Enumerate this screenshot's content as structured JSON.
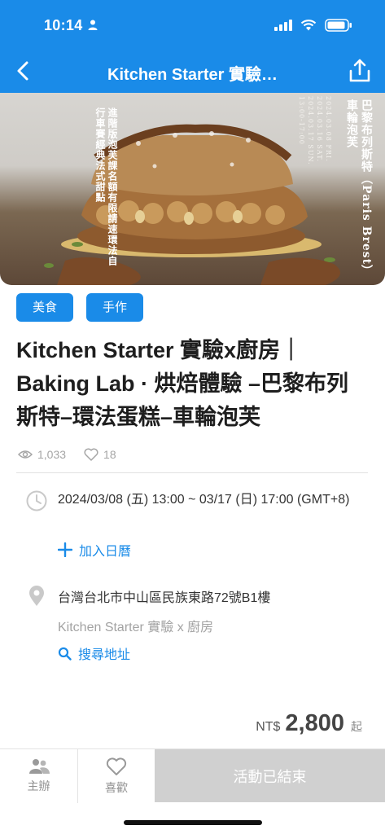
{
  "status_bar": {
    "time": "10:14"
  },
  "nav": {
    "title": "Kitchen Starter 實驗…"
  },
  "hero": {
    "left_text": "進階版泡芙課名額有限請速環法自行車賽經典法式甜點",
    "right_title": "巴黎布列斯特（Paris Brest）車輪泡芙",
    "dates": "2024.03.08 FRI. 2024.03.16 SAT. 2024.03.17 SUN. 13:00-17:00"
  },
  "tags": [
    "美食",
    "手作"
  ],
  "event_title": "Kitchen Starter 實驗x廚房｜Baking Lab · 烘焙體驗 –巴黎布列斯特–環法蛋糕–車輪泡芙",
  "stats": {
    "views": "1,033",
    "likes": "18"
  },
  "schedule": {
    "time": "2024/03/08 (五) 13:00 ~ 03/17 (日) 17:00 (GMT+8)",
    "add_calendar": "加入日曆"
  },
  "location": {
    "address": "台灣台北市中山區民族東路72號B1樓",
    "venue": "Kitchen Starter 實驗 x 廚房",
    "search": "搜尋地址"
  },
  "price": {
    "currency": "NT$",
    "value": "2,800",
    "suffix": "起"
  },
  "bottom_bar": {
    "host": "主辦",
    "like": "喜歡",
    "status": "活動已結束"
  },
  "colors": {
    "primary": "#1a8be8",
    "ended": "#d0d0d0"
  }
}
